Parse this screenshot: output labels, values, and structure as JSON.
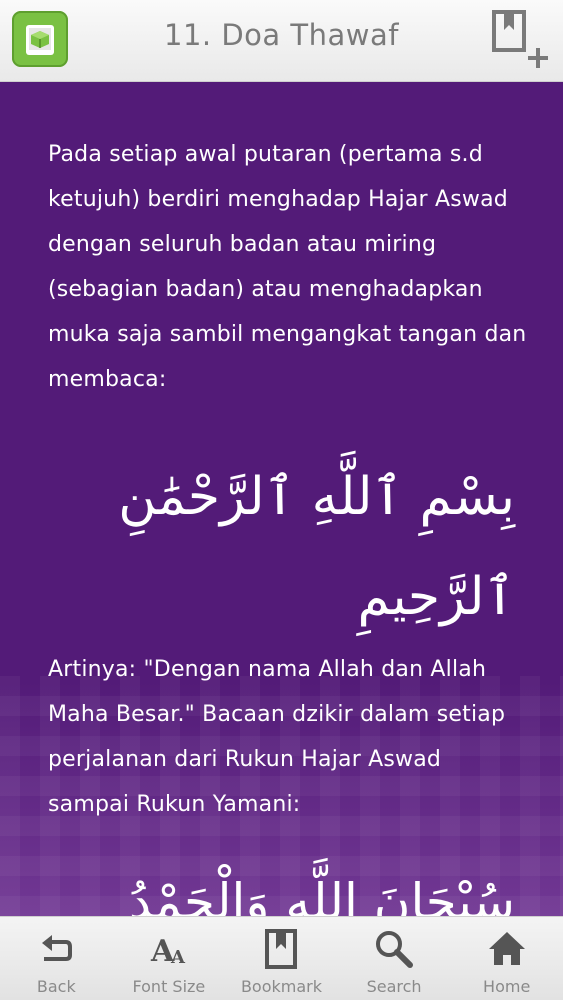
{
  "header": {
    "title": "11. Doa Thawaf"
  },
  "content": {
    "paragraph_1": "Pada setiap awal putaran (pertama s.d ketujuh) berdiri menghadap Hajar Aswad dengan seluruh badan atau miring (sebagian badan) atau menghadapkan muka saja sambil mengangkat tangan dan membaca:",
    "arabic_1": "بِسْمِ ٱللَّهِ ٱلرَّحْمَٰنِ ٱلرَّحِيمِ",
    "paragraph_2": "Artinya: \"Dengan nama Allah dan Allah Maha Besar.\" Bacaan dzikir dalam setiap perjalanan dari Rukun Hajar Aswad sampai Rukun Yamani:",
    "arabic_2": "سُبْحَانَ اللَّهِ وَالْحَمْدُ لِلَّهِ"
  },
  "bottom_nav": {
    "back": "Back",
    "font_size": "Font Size",
    "bookmark": "Bookmark",
    "search": "Search",
    "home": "Home"
  },
  "colors": {
    "header_bg": "#f2f2f2",
    "content_bg": "#531b78",
    "app_icon": "#7ac143",
    "text": "#ffffff",
    "nav_text": "#8a8a8a"
  },
  "icons": [
    "book-icon",
    "add-bookmark-icon",
    "back-arrow-icon",
    "font-size-icon",
    "bookmark-icon",
    "search-icon",
    "home-icon"
  ]
}
